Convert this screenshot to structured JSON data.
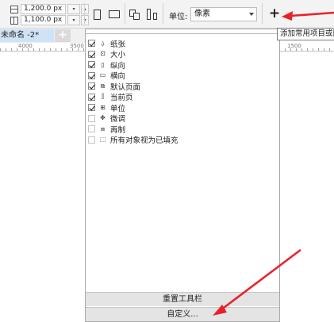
{
  "propbar": {
    "width_value": "1,200.0 px",
    "height_value": "1,100.0 px",
    "unit_label": "单位:",
    "unit_value": "像素",
    "add_button_label": "+"
  },
  "doc_tab": {
    "title": "未命名 -2*",
    "add_label": "+"
  },
  "rulers": {
    "left_labels": [
      "4000",
      "3500"
    ],
    "right_label": "1500"
  },
  "tooltip": {
    "text": "添加常用项目或删"
  },
  "menu": {
    "items": [
      {
        "label": "纸张",
        "checked": true,
        "icon": "paper-icon"
      },
      {
        "label": "大小",
        "checked": true,
        "icon": "size-icon"
      },
      {
        "label": "纵向",
        "checked": true,
        "icon": "portrait-icon"
      },
      {
        "label": "横向",
        "checked": true,
        "icon": "landscape-icon"
      },
      {
        "label": "默认页面",
        "checked": true,
        "icon": "all-pages-icon"
      },
      {
        "label": "当前页",
        "checked": true,
        "icon": "current-page-icon"
      },
      {
        "label": "单位",
        "checked": true,
        "icon": "units-icon"
      },
      {
        "label": "微调",
        "checked": false,
        "icon": "nudge-icon"
      },
      {
        "label": "再制",
        "checked": false,
        "icon": "duplicate-icon"
      },
      {
        "label": "所有对象视为已填充",
        "checked": false,
        "icon": "treat-filled-icon"
      }
    ],
    "reset_label": "重置工具栏",
    "customize_label": "自定义..."
  },
  "colors": {
    "annotation": "#e8222b",
    "tab_active": "#cfe3f6"
  }
}
